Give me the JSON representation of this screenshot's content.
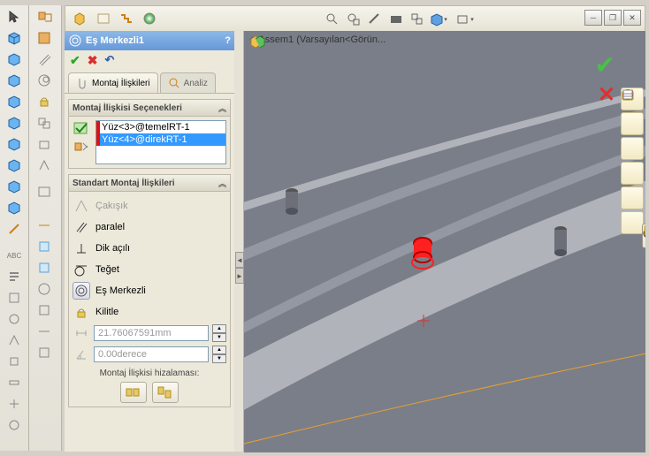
{
  "pm": {
    "title": "Eş Merkezli1",
    "help_symbol": "?",
    "tabs": {
      "mates": "Montaj İlişkileri",
      "analysis": "Analiz"
    },
    "sections": {
      "options": "Montaj İlişkisi Seçenekleri",
      "standard": "Standart Montaj İlişkileri"
    },
    "selections": [
      "Yüz<3>@temelRT-1",
      "Yüz<4>@direkRT-1"
    ],
    "mates": {
      "coincident": "Çakışık",
      "parallel": "paralel",
      "perpendicular": "Dik açılı",
      "tangent": "Teğet",
      "concentric": "Eş Merkezli",
      "lock": "Kilitle",
      "distance_value": "21.76067591mm",
      "angle_value": "0.00derece"
    },
    "alignment_label": "Montaj İlişkisi hizalaması:"
  },
  "assembly": {
    "name": "Assem1 (Varsayılan<Görün...",
    "plus": "+"
  }
}
